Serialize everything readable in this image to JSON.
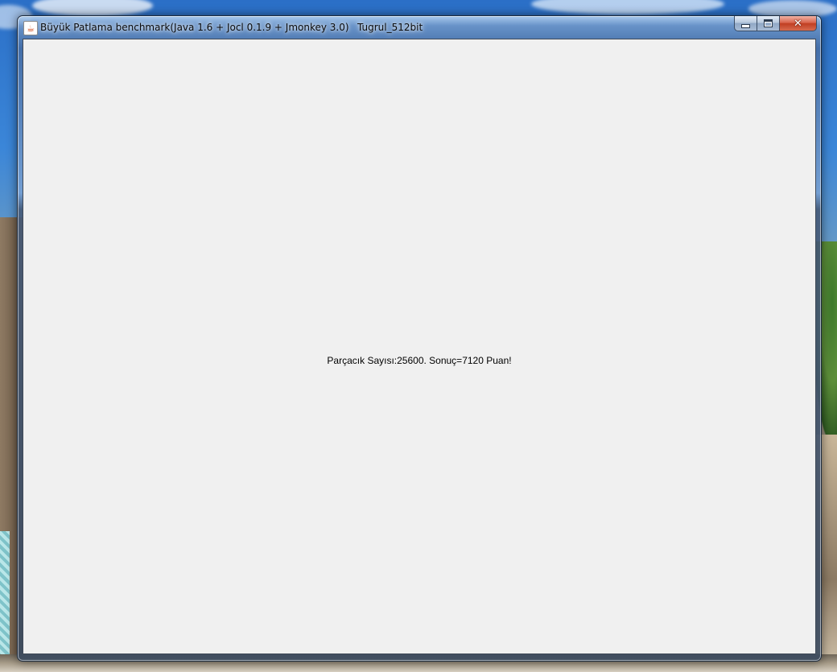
{
  "window": {
    "title": "Büyük Patlama benchmark(Java 1.6 + Jocl 0.1.9 + Jmonkey 3.0)",
    "user_label": "Tugrul_512bit",
    "app_icon": "java-cup-icon",
    "caption_buttons": {
      "minimize_icon": "minimize-icon",
      "maximize_icon": "maximize-icon",
      "close_glyph": "✕"
    }
  },
  "content": {
    "message": "Parçacık Sayısı:25600. Sonuç=7120 Puan!"
  },
  "colors": {
    "client_background": "#f0f0f0",
    "close_button": "#c13e22",
    "text": "#000000"
  }
}
